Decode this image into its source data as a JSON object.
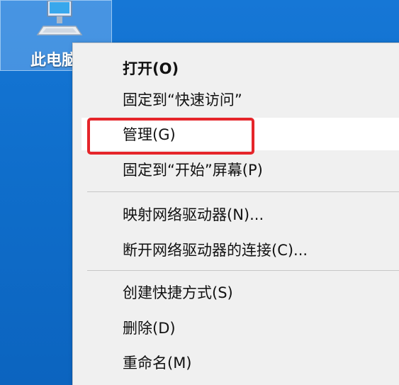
{
  "desktop": {
    "icon": {
      "icon_name": "this-pc-icon",
      "label": "此电脑"
    },
    "accent_color": "#1677d6"
  },
  "context_menu": {
    "items": [
      {
        "label": "打开(O)",
        "bold": true
      },
      {
        "label": "固定到“快速访问”"
      },
      {
        "label": "管理(G)",
        "highlighted": true
      },
      {
        "label": "固定到“开始”屏幕(P)"
      },
      {
        "label": "映射网络驱动器(N)..."
      },
      {
        "label": "断开网络驱动器的连接(C)..."
      },
      {
        "label": "创建快捷方式(S)"
      },
      {
        "label": "删除(D)"
      },
      {
        "label": "重命名(M)"
      }
    ],
    "annotation_color": "#e5252a"
  }
}
